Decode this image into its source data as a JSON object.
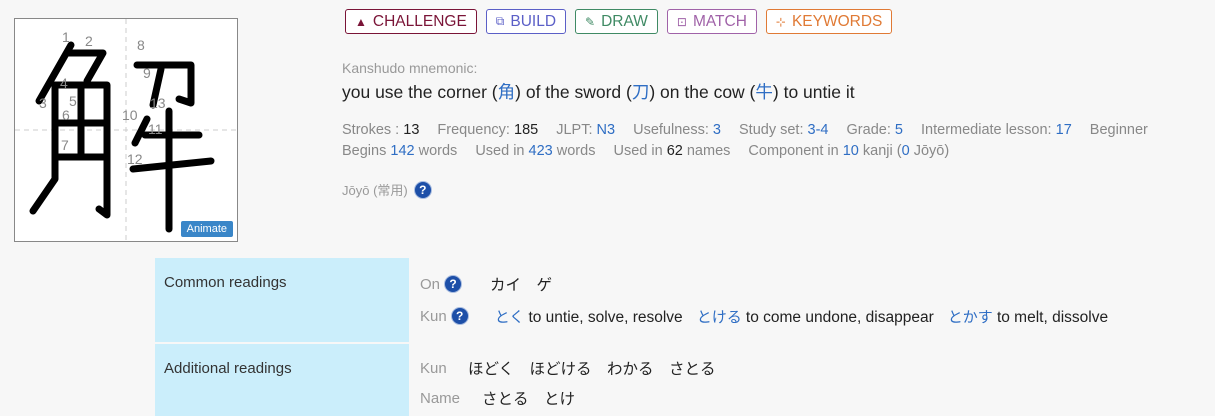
{
  "kanji": {
    "character": "解",
    "stroke_numbers": [
      "1",
      "2",
      "3",
      "4",
      "5",
      "6",
      "7",
      "8",
      "9",
      "10",
      "11",
      "12",
      "13"
    ],
    "animate_label": "Animate"
  },
  "buttons": [
    {
      "label": "CHALLENGE",
      "color": "#7a1437",
      "icon": "mountain-icon"
    },
    {
      "label": "BUILD",
      "color": "#5b5fc7",
      "icon": "blocks-icon"
    },
    {
      "label": "DRAW",
      "color": "#3f8a64",
      "icon": "pen-icon"
    },
    {
      "label": "MATCH",
      "color": "#a062a8",
      "icon": "match-icon"
    },
    {
      "label": "KEYWORDS",
      "color": "#e07a35",
      "icon": "keywords-icon"
    }
  ],
  "mnemonic": {
    "label": "Kanshudo mnemonic:",
    "p1": "you use the corner (",
    "k1": "角",
    "p2": ") of the sword (",
    "k2": "刀",
    "p3": ") on the cow (",
    "k3": "牛",
    "p4": ") to untie it"
  },
  "stats": {
    "strokes_label": "Strokes :",
    "strokes": "13",
    "frequency_label": "Frequency:",
    "frequency": "185",
    "jlpt_label": "JLPT:",
    "jlpt": "N3",
    "usefulness_label": "Usefulness:",
    "usefulness": "3",
    "studyset_label": "Study set:",
    "studyset": "3-4",
    "grade_label": "Grade:",
    "grade": "5",
    "intermediate_label": "Intermediate lesson:",
    "intermediate": "17",
    "beginner_label": "Beginner",
    "begins_label": "Begins",
    "begins": "142",
    "words_label": "words",
    "usedin_label": "Used in",
    "usedin": "423",
    "words2_label": "words",
    "names_prefix": "Used in",
    "names": "62",
    "names_label": "names",
    "component_label": "Component in",
    "component": "10",
    "component_suffix": "kanji (",
    "component_joyo": "0",
    "component_end": "Jōyō)"
  },
  "joyo": {
    "label": "Jōyō (常用)"
  },
  "readings": {
    "common_label": "Common readings",
    "on_label": "On",
    "on_values": "カイ　ゲ",
    "kun_label": "Kun",
    "kun": [
      {
        "prefix": "と",
        "okurigana": "く",
        "meaning": "to untie, solve, resolve"
      },
      {
        "prefix": "と",
        "okurigana": "ける",
        "meaning": "to come undone, disappear"
      },
      {
        "prefix": "と",
        "okurigana": "かす",
        "meaning": "to melt, dissolve"
      }
    ],
    "additional_label": "Additional readings",
    "add_kun_label": "Kun",
    "add_kun_values": "ほどく　ほどける　わかる　さとる",
    "name_label": "Name",
    "name_values": "さとる　とけ"
  }
}
